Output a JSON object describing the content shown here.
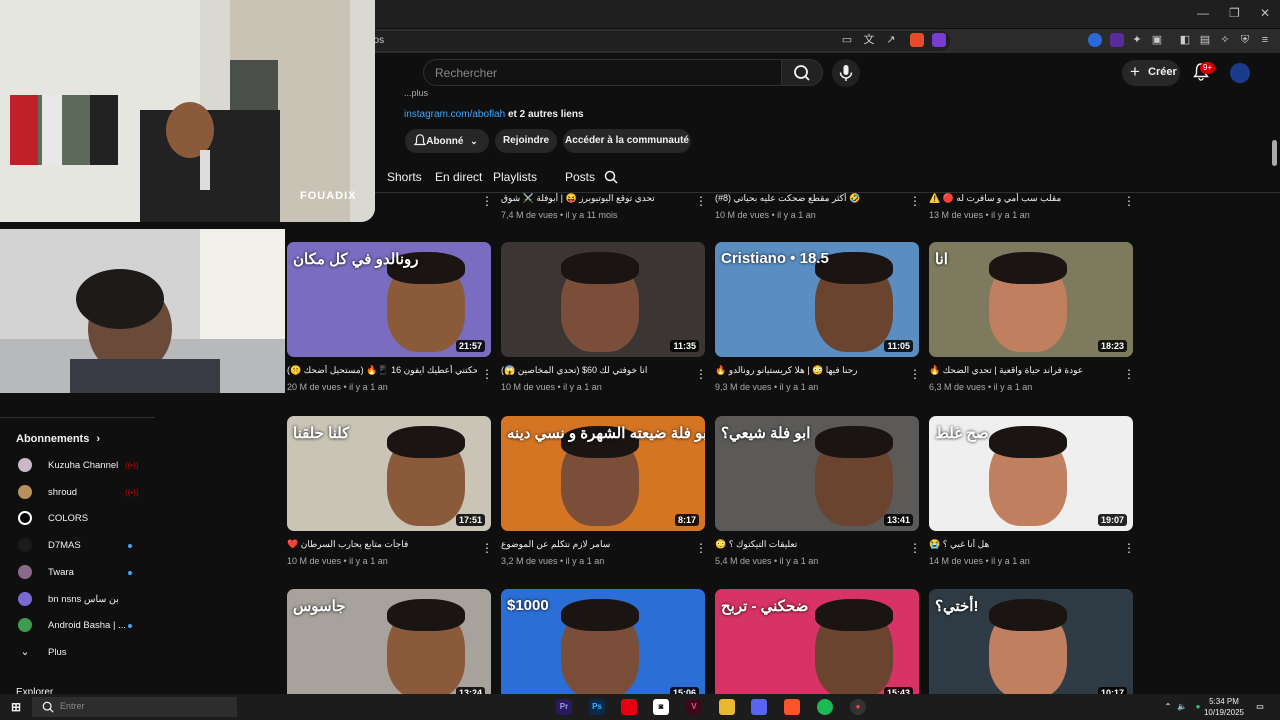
{
  "browser": {
    "url_fragment": "eos",
    "window_controls": [
      "—",
      "❐",
      "✕"
    ]
  },
  "header": {
    "search_placeholder": "Rechercher",
    "create_label": "Créer",
    "notif_count": "9+"
  },
  "channel": {
    "description": "...plus",
    "link_url": "instagram.com/aboflah",
    "link_more": " et 2 autres liens",
    "subscribed_label": "Abonné",
    "join_label": "Rejoindre",
    "community_label": "Accéder à la communauté",
    "tabs": [
      "Shorts",
      "En direct",
      "Playlists",
      "Posts"
    ]
  },
  "sidebar": {
    "section_title": "Abonnements",
    "items": [
      {
        "label": "Kuzuha Channel",
        "status": "live",
        "color": "#c8b8c8"
      },
      {
        "label": "shroud",
        "status": "live",
        "color": "#b89060"
      },
      {
        "label": "COLORS",
        "status": "none",
        "color": "#ffffff"
      },
      {
        "label": "D7MAS",
        "status": "dot",
        "color": "#1b1b1b"
      },
      {
        "label": "Twara",
        "status": "dot",
        "color": "#8a6a8a"
      },
      {
        "label": "bn nsns بن ساس",
        "status": "none",
        "color": "#7b6ad0"
      },
      {
        "label": "Android Basha | ...",
        "status": "dot",
        "color": "#3d9a50"
      }
    ],
    "more_label": "Plus",
    "explorer_label": "Explorer"
  },
  "videos_top_row": [
    {
      "title": "",
      "meta": "il y a 11 mois"
    },
    {
      "title": "تحدي توقع اليوتيوبرز 😝 | أبوفلة ⚔️ شوق",
      "meta": "7,4 M de vues • il y a 11 mois"
    },
    {
      "title": "(#8) أكثر مقطع ضحكت عليه بحياتي 🤣",
      "meta": "10 M de vues • il y a 1 an"
    },
    {
      "title": "⚠️ 🔴 مقلب سب أمي و سافرت له",
      "meta": "13 M de vues • il y a 1 an"
    }
  ],
  "videos": [
    {
      "title": "إذا ضحكتني أعطيك ايفون 16 📱🔥 (مستحيل أضحك 🤫)",
      "meta": "20 M de vues • il y a 1 an",
      "duration": "21:57",
      "overlay": "رونالدو في كل مكان",
      "bg": "#7a6cc0"
    },
    {
      "title": "انا خوفتي لك 60$ (تحدي المخاصين 😱)",
      "meta": "10 M de vues • il y a 1 an",
      "duration": "11:35",
      "overlay": "",
      "bg": "#3b3633"
    },
    {
      "title": "🔥 رحنا فيها 😳 | هلا كريستيانو رونالدو",
      "meta": "9,3 M de vues • il y a 1 an",
      "duration": "11:05",
      "overlay": "Cristiano • 18.5",
      "bg": "#5a8ec2"
    },
    {
      "title": "🔥 عودة فراند حياة واقعية | تحدي الضحك",
      "meta": "6,3 M de vues • il y a 1 an",
      "duration": "18:23",
      "overlay": "انا",
      "bg": "#7d7a5e"
    },
    {
      "title": "❤️ فاجأت متابع يحارب السرطان",
      "meta": "10 M de vues • il y a 1 an",
      "duration": "17:51",
      "overlay": "كلنا حلقنا",
      "bg": "#c9c4b6"
    },
    {
      "title": "سامر لازم نتكلم عن الموضوع",
      "meta": "3,2 M de vues • il y a 1 an",
      "duration": "8:17",
      "overlay": "ابو فلة ضيعته الشهرة و نسي دينه",
      "bg": "#d57524"
    },
    {
      "title": "😳 تعليقات التيكتوك ؟",
      "meta": "5,4 M de vues • il y a 1 an",
      "duration": "13:41",
      "overlay": "ابو فلة شيعي؟",
      "bg": "#5b5a58"
    },
    {
      "title": "😭 هل أنا غبي ؟",
      "meta": "14 M de vues • il y a 1 an",
      "duration": "19:07",
      "overlay": "صح غلط",
      "bg": "#efefef"
    },
    {
      "title": "",
      "meta": "",
      "duration": "13:24",
      "overlay": "جاسوس",
      "bg": "#a7a39c"
    },
    {
      "title": "",
      "meta": "",
      "duration": "15:06",
      "overlay": "$1000",
      "bg": "#2b6fd6"
    },
    {
      "title": "",
      "meta": "",
      "duration": "15:43",
      "overlay": "ضحكني - تربح",
      "bg": "#d73366"
    },
    {
      "title": "",
      "meta": "",
      "duration": "10:17",
      "overlay": "أختي؟!",
      "bg": "#2f3b44"
    }
  ],
  "webcam": {
    "name": "FOUADIX"
  },
  "taskbar": {
    "search_placeholder": "Entrer",
    "time": "5:34 PM",
    "date": "10/19/2025"
  },
  "colors": {
    "accent": "#3ea6ff",
    "live": "#cc0000",
    "bg": "#0f0f0f"
  }
}
